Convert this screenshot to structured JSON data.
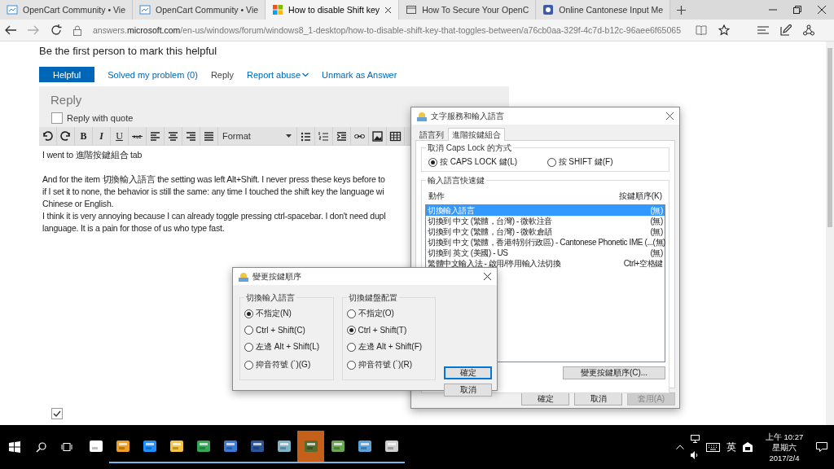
{
  "browser": {
    "tabs": [
      {
        "title": "OpenCart Community • Vie",
        "selected": false
      },
      {
        "title": "OpenCart Community • Vie",
        "selected": false
      },
      {
        "title": "How to disable Shift key",
        "selected": true
      },
      {
        "title": "How To Secure Your OpenC",
        "selected": false
      },
      {
        "title": "Online Cantonese Input Me",
        "selected": false
      }
    ],
    "address": "answers.**microsoft.com**/en-us/windows/forum/windows8_1-desktop/how-to-disable-shift-key-that-toggles-between/a76cb0aa-329f-4c7d-b12c-96aee6f65065"
  },
  "page": {
    "helpful_prompt": "Be the first person to mark this helpful",
    "actions": [
      {
        "label": "Helpful",
        "kind": "primary"
      },
      {
        "label": "Solved my problem (0)",
        "kind": "link"
      },
      {
        "label": "Reply",
        "kind": "plain"
      },
      {
        "label": "Report abuse",
        "kind": "dropdown"
      },
      {
        "label": "Unmark as Answer",
        "kind": "link"
      }
    ],
    "reply": {
      "title": "Reply",
      "quote_option": {
        "label": "Reply with quote",
        "checked": false
      },
      "toolbar": {
        "format_buttons": [
          "B",
          "I",
          "U"
        ],
        "format_select": "Format"
      },
      "body_lines": [
        "I went to 進階按鍵組合 tab",
        "And for the item 切換輸入語言 the setting was left Alt+Shift. I never press these keys before to",
        "if I set it to none, the behavior is still the same: any time I touched the shift key the language wi",
        "Chinese or English.",
        "I think it is very annoying because I can already toggle pressing ctrl-spacebar. I don't need dupl",
        "language. It is a pain for those of us who type fast."
      ]
    },
    "notify": {
      "checked": true
    }
  },
  "language_dialog": {
    "title": "文字服務和輸入語言",
    "tabs": [
      {
        "label": "語言列",
        "selected": false
      },
      {
        "label": "進階按鍵組合",
        "selected": true
      }
    ],
    "caps_group": {
      "title": "取消 Caps Lock 的方式",
      "options": [
        {
          "label": "按 CAPS LOCK 鍵(L)",
          "selected": true
        },
        {
          "label": "按 SHIFT 鍵(F)",
          "selected": false
        }
      ]
    },
    "hotkeys_group": {
      "title": "輸入語言快速鍵",
      "columns": [
        "動作",
        "按鍵順序(K)"
      ],
      "rows": [
        {
          "action": "切換輸入語言",
          "keys": "(無)",
          "selected": true
        },
        {
          "action": "切換到 中文 (繁體，台灣) - 微軟注音",
          "keys": "(無)",
          "selected": false
        },
        {
          "action": "切換到 中文 (繁體，台灣) - 微軟倉頡",
          "keys": "(無)",
          "selected": false
        },
        {
          "action": "切換到 中文 (繁體，香港特別行政區) - Cantonese Phonetic IME (...",
          "keys": "(無)",
          "selected": false
        },
        {
          "action": "切換到 英文 (美國) - US",
          "keys": "(無)",
          "selected": false
        },
        {
          "action": "繁體中文輸入法 - 啟用/停用輸入法切換",
          "keys": "Ctrl+空格鍵",
          "selected": false
        }
      ],
      "change_button": "變更按鍵順序(C)..."
    },
    "buttons": [
      {
        "label": "確定",
        "disabled": false
      },
      {
        "label": "取消",
        "disabled": false
      },
      {
        "label": "套用(A)",
        "disabled": true
      }
    ]
  },
  "hotkey_dialog": {
    "title": "變更按鍵順序",
    "groups": [
      {
        "title": "切換輸入語言",
        "options": [
          {
            "label": "不指定(N)",
            "selected": true
          },
          {
            "label": "Ctrl + Shift(C)",
            "selected": false
          },
          {
            "label": "左邊 Alt + Shift(L)",
            "selected": false
          },
          {
            "label": "抑音符號 (`)(G)",
            "selected": false
          }
        ]
      },
      {
        "title": "切換鍵盤配置",
        "options": [
          {
            "label": "不指定(O)",
            "selected": false
          },
          {
            "label": "Ctrl + Shift(T)",
            "selected": true
          },
          {
            "label": "左邊 Alt + Shift(F)",
            "selected": false
          },
          {
            "label": "抑音符號 (`)(R)",
            "selected": false
          }
        ]
      }
    ],
    "buttons": [
      {
        "label": "確定",
        "focused": true
      },
      {
        "label": "取消",
        "focused": false
      }
    ]
  },
  "taskbar": {
    "apps": [
      {
        "running": false,
        "selected": false
      },
      {
        "running": true,
        "selected": false
      },
      {
        "running": true,
        "selected": false
      },
      {
        "running": true,
        "selected": false
      },
      {
        "running": true,
        "selected": false
      },
      {
        "running": true,
        "selected": false
      },
      {
        "running": true,
        "selected": false
      },
      {
        "running": true,
        "selected": false
      },
      {
        "running": true,
        "selected": true
      },
      {
        "running": true,
        "selected": false
      },
      {
        "running": true,
        "selected": false
      },
      {
        "running": true,
        "selected": false
      }
    ],
    "ime_mode": "英",
    "time": "上午 10:27",
    "weekday": "星期六",
    "date": "2017/2/4"
  }
}
